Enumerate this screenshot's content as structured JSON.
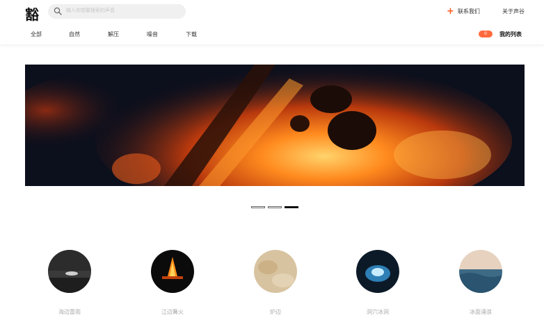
{
  "header": {
    "logo": "豁",
    "search_placeholder": "输入你想要搜索的声音",
    "contact_label": "联系我们",
    "about_label": "关于声谷",
    "nav": [
      "全部",
      "自然",
      "解压",
      "噪音",
      "下载"
    ],
    "list_count": "0",
    "mylist_label": "我的列表",
    "accent_color": "#ff5a1f"
  },
  "banner": {
    "image": "campfire-embers",
    "slides_total": 3,
    "active_slide": 3
  },
  "categories": [
    {
      "label": "海边雷雨",
      "image": "stormy-shore"
    },
    {
      "label": "江边篝火",
      "image": "campfire"
    },
    {
      "label": "炉边",
      "image": "fireside-sand"
    },
    {
      "label": "洞穴冰洞",
      "image": "ice-cave"
    },
    {
      "label": "冰面涌浪",
      "image": "ocean-waves"
    }
  ]
}
